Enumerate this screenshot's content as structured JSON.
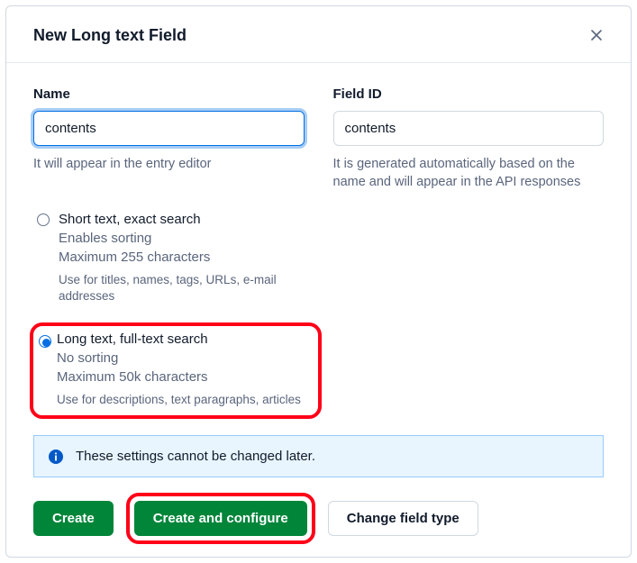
{
  "modal": {
    "title": "New Long text Field"
  },
  "fields": {
    "name": {
      "label": "Name",
      "value": "contents",
      "help": "It will appear in the entry editor"
    },
    "field_id": {
      "label": "Field ID",
      "value": "contents",
      "help": "It is generated automatically based on the name and will appear in the API responses"
    }
  },
  "options": [
    {
      "title": "Short text, exact search",
      "line1": "Enables sorting",
      "line2": "Maximum 255 characters",
      "hint": "Use for titles, names, tags, URLs, e-mail addresses",
      "selected": false
    },
    {
      "title": "Long text, full-text search",
      "line1": "No sorting",
      "line2": "Maximum 50k characters",
      "hint": "Use for descriptions, text paragraphs, articles",
      "selected": true
    }
  ],
  "notice": "These settings cannot be changed later.",
  "actions": {
    "create": "Create",
    "create_configure": "Create and configure",
    "change_type": "Change field type"
  }
}
